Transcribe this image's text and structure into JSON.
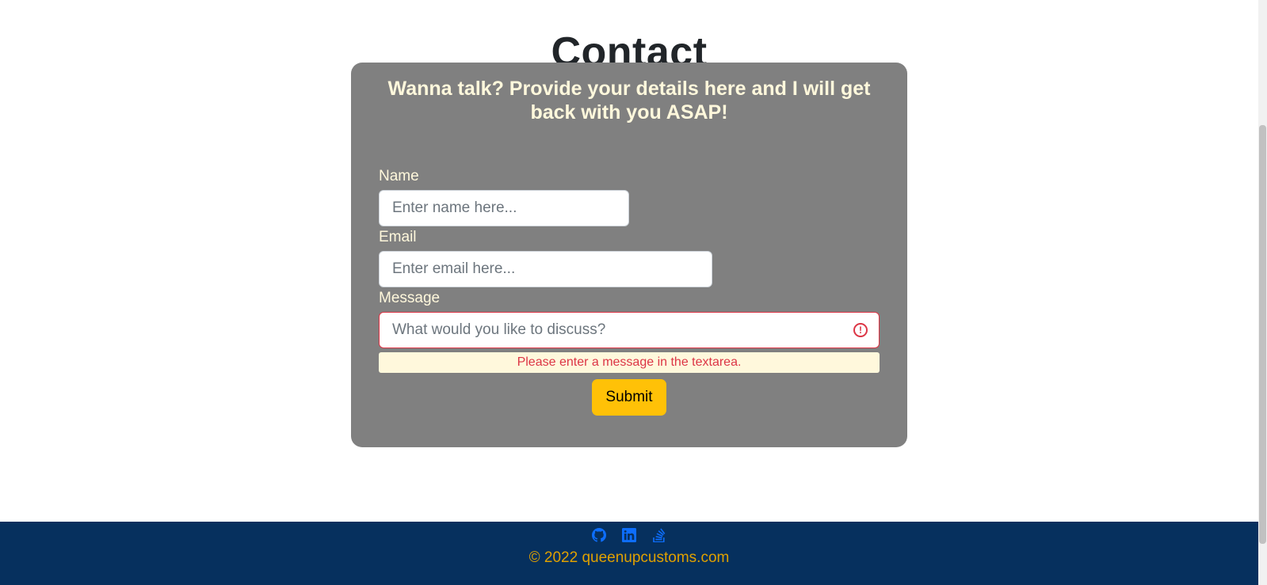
{
  "page": {
    "title": "Contact"
  },
  "form": {
    "heading": "Wanna talk? Provide your details here and I will get back with you ASAP!",
    "name_label": "Name",
    "name_placeholder": "Enter name here...",
    "email_label": "Email",
    "email_placeholder": "Enter email here...",
    "message_label": "Message",
    "message_placeholder": "What would you like to discuss?",
    "message_error": "Please enter a message in the textarea.",
    "submit_label": "Submit"
  },
  "footer": {
    "icons": [
      "github-icon",
      "linkedin-icon",
      "stackoverflow-icon"
    ],
    "copyright": "© 2022 queenupcustoms.com"
  },
  "colors": {
    "card_background": "#808080",
    "heading_text": "#fff8dc",
    "submit_background": "#ffc107",
    "footer_background": "#06305e",
    "footer_icon": "#0d6efd",
    "copyright_text": "#e0a100",
    "error": "#dc3545"
  }
}
